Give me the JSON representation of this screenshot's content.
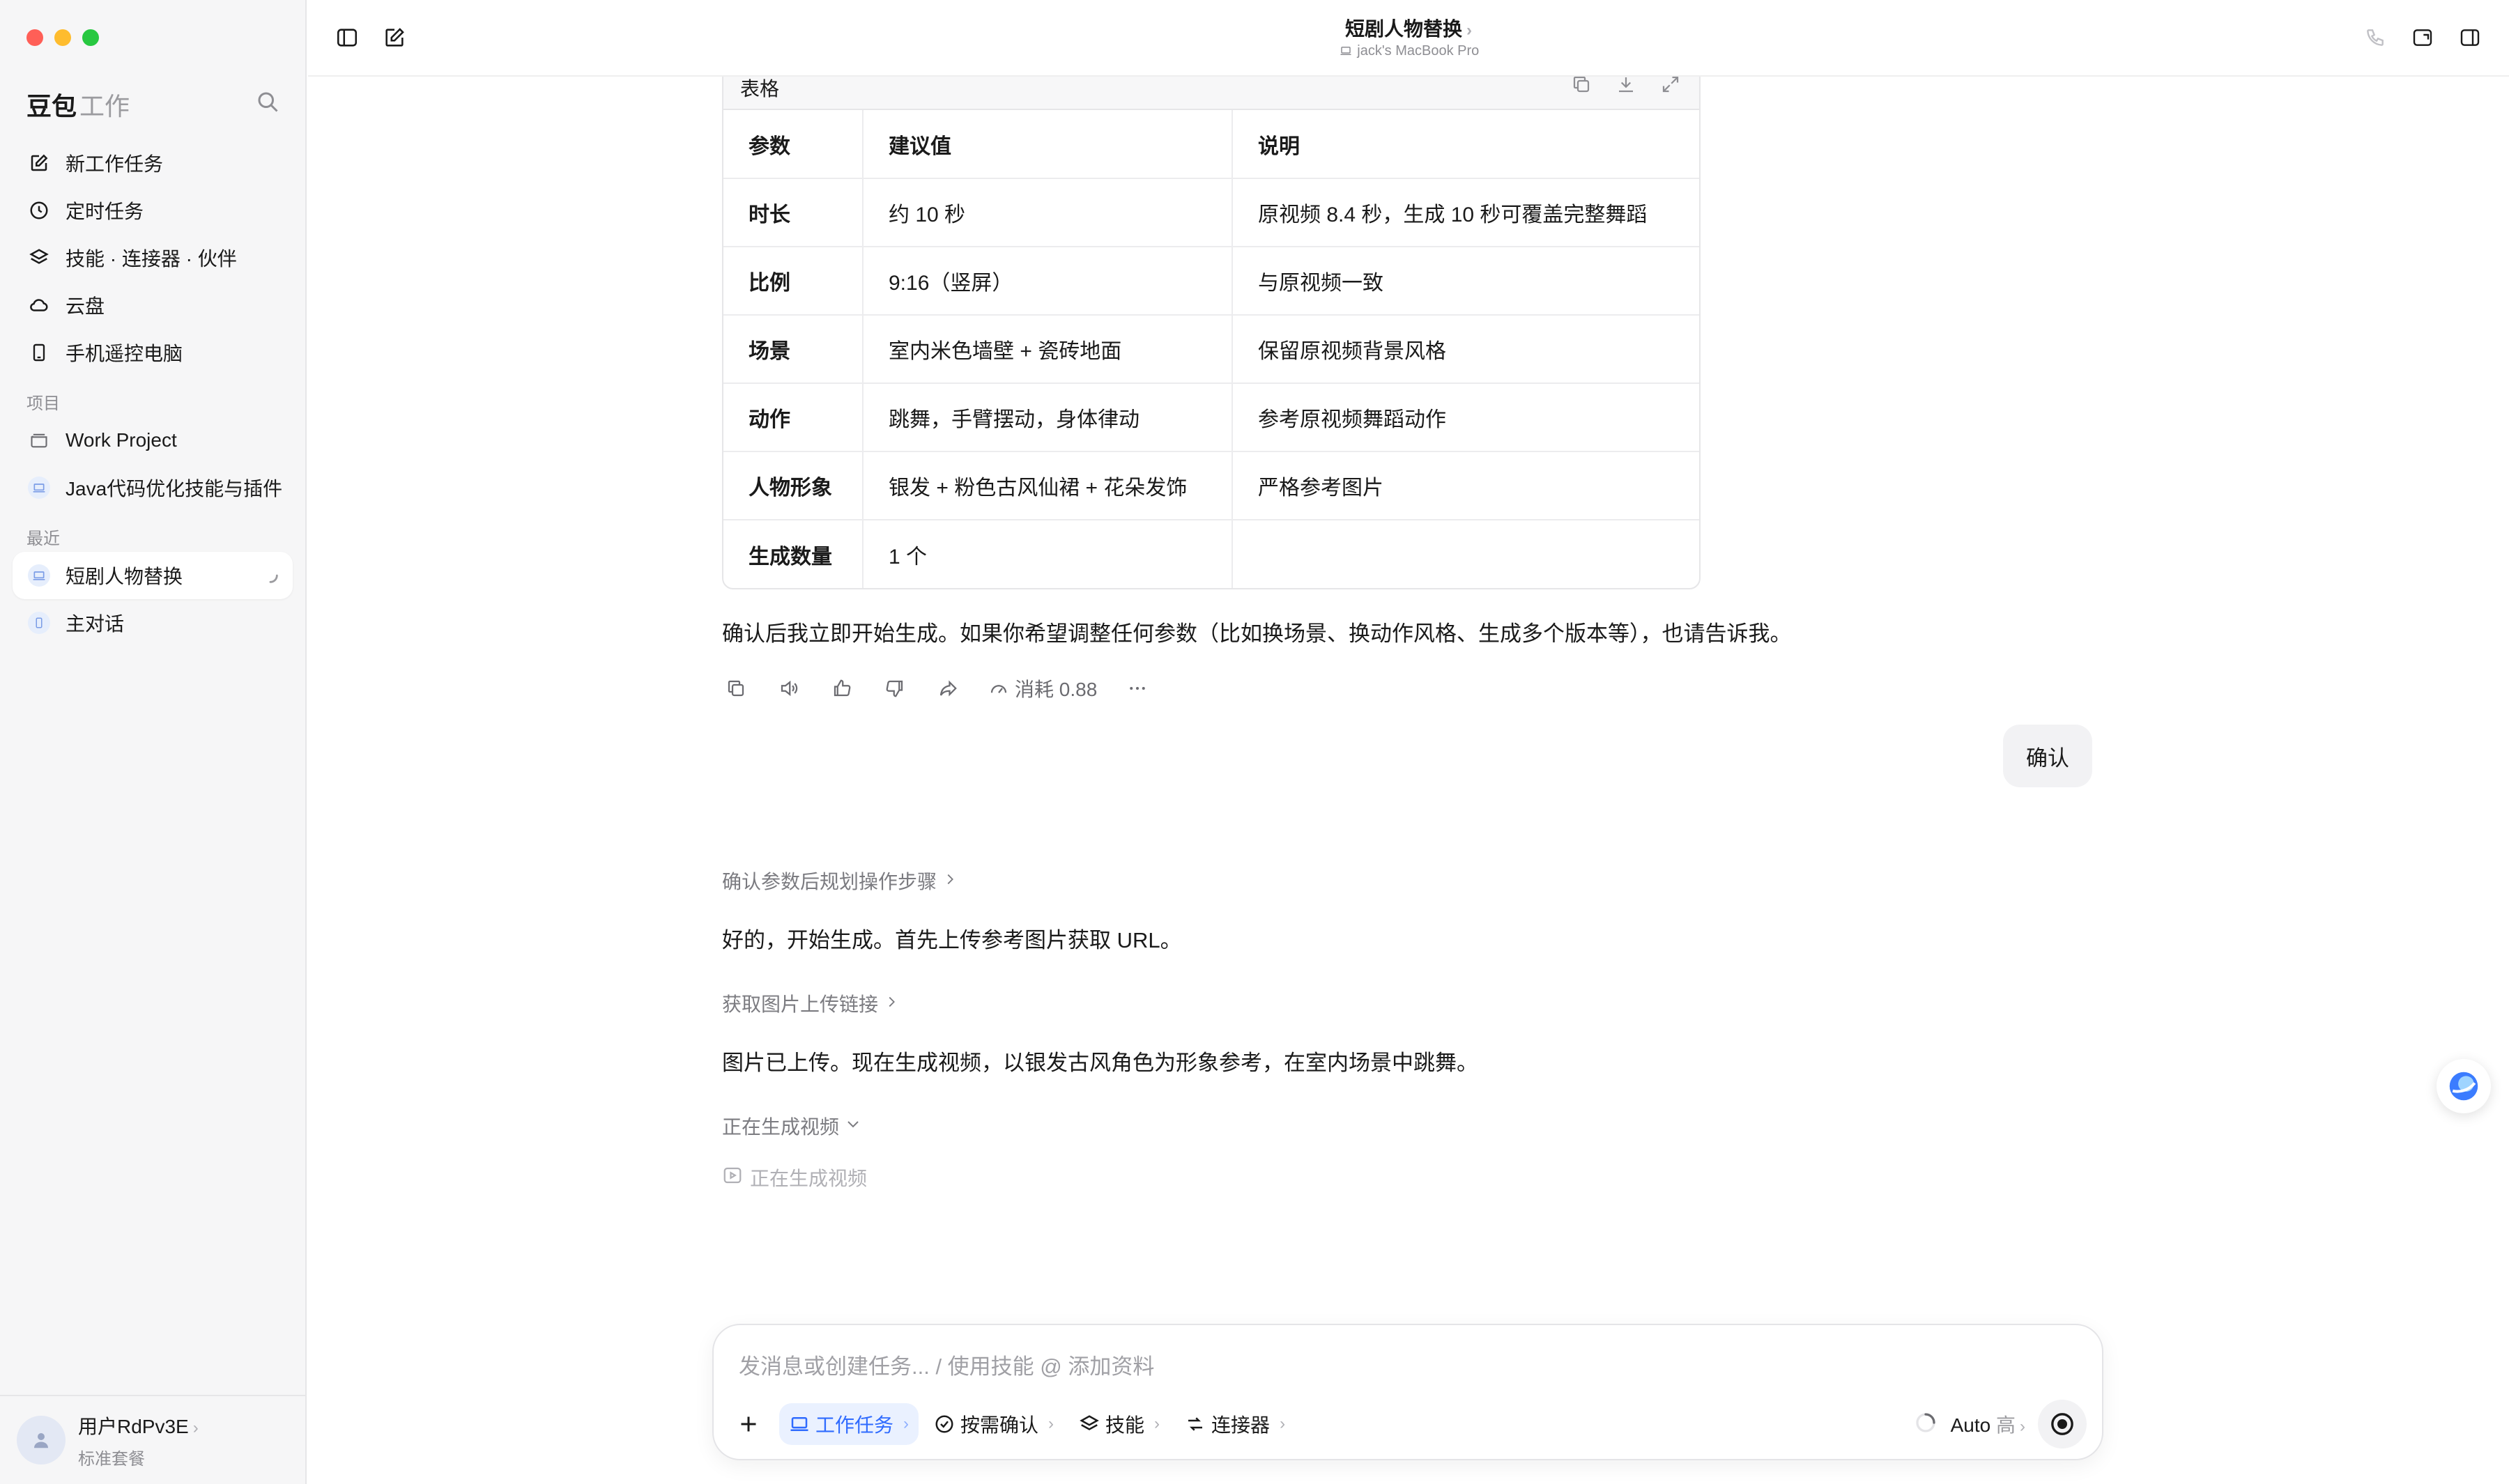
{
  "sidebar": {
    "brand": "豆包",
    "brand_sub": "工作",
    "nav": [
      {
        "label": "新工作任务",
        "icon": "edit-icon"
      },
      {
        "label": "定时任务",
        "icon": "clock-icon"
      },
      {
        "label": "技能 · 连接器 · 伙伴",
        "icon": "layers-icon"
      },
      {
        "label": "云盘",
        "icon": "cloud-icon"
      },
      {
        "label": "手机遥控电脑",
        "icon": "phone-icon"
      }
    ],
    "projects_title": "项目",
    "projects": [
      {
        "label": "Work Project"
      },
      {
        "label": "Java代码优化技能与插件"
      }
    ],
    "recent_title": "最近",
    "recent": [
      {
        "label": "短剧人物替换",
        "active": true
      },
      {
        "label": "主对话"
      }
    ],
    "user": {
      "name": "用户RdPv3E",
      "plan": "标准套餐"
    }
  },
  "topbar": {
    "title": "短剧人物替换",
    "device": "jack's MacBook Pro"
  },
  "table": {
    "label": "表格",
    "headers": [
      "参数",
      "建议值",
      "说明"
    ],
    "rows": [
      [
        "时长",
        "约 10 秒",
        "原视频 8.4 秒，生成 10 秒可覆盖完整舞蹈"
      ],
      [
        "比例",
        "9:16（竖屏）",
        "与原视频一致"
      ],
      [
        "场景",
        "室内米色墙壁 + 瓷砖地面",
        "保留原视频背景风格"
      ],
      [
        "动作",
        "跳舞，手臂摆动，身体律动",
        "参考原视频舞蹈动作"
      ],
      [
        "人物形象",
        "银发 + 粉色古风仙裙 + 花朵发饰",
        "严格参考图片"
      ],
      [
        "生成数量",
        "1 个",
        ""
      ]
    ]
  },
  "messages": {
    "confirm_prompt": "确认后我立即开始生成。如果你希望调整任何参数（比如换场景、换动作风格、生成多个版本等），也请告诉我。",
    "cost": "消耗 0.88",
    "user_bubble": "确认",
    "step1": "确认参数后规划操作步骤",
    "reply1": "好的，开始生成。首先上传参考图片获取 URL。",
    "step2": "获取图片上传链接",
    "reply2": "图片已上传。现在生成视频，以银发古风角色为形象参考，在室内场景中跳舞。",
    "step3": "正在生成视频",
    "generating": "正在生成视频"
  },
  "composer": {
    "placeholder": "发消息或创建任务... / 使用技能 @ 添加资料",
    "chips": [
      {
        "label": "工作任务",
        "icon": "laptop-icon"
      },
      {
        "label": "按需确认",
        "icon": "check-circle-icon"
      },
      {
        "label": "技能",
        "icon": "layers-icon"
      },
      {
        "label": "连接器",
        "icon": "connector-icon"
      }
    ],
    "model": "Auto",
    "level": "高"
  },
  "colors": {
    "accent": "#2f6bff",
    "sidebar_bg": "#f6f6f7"
  }
}
